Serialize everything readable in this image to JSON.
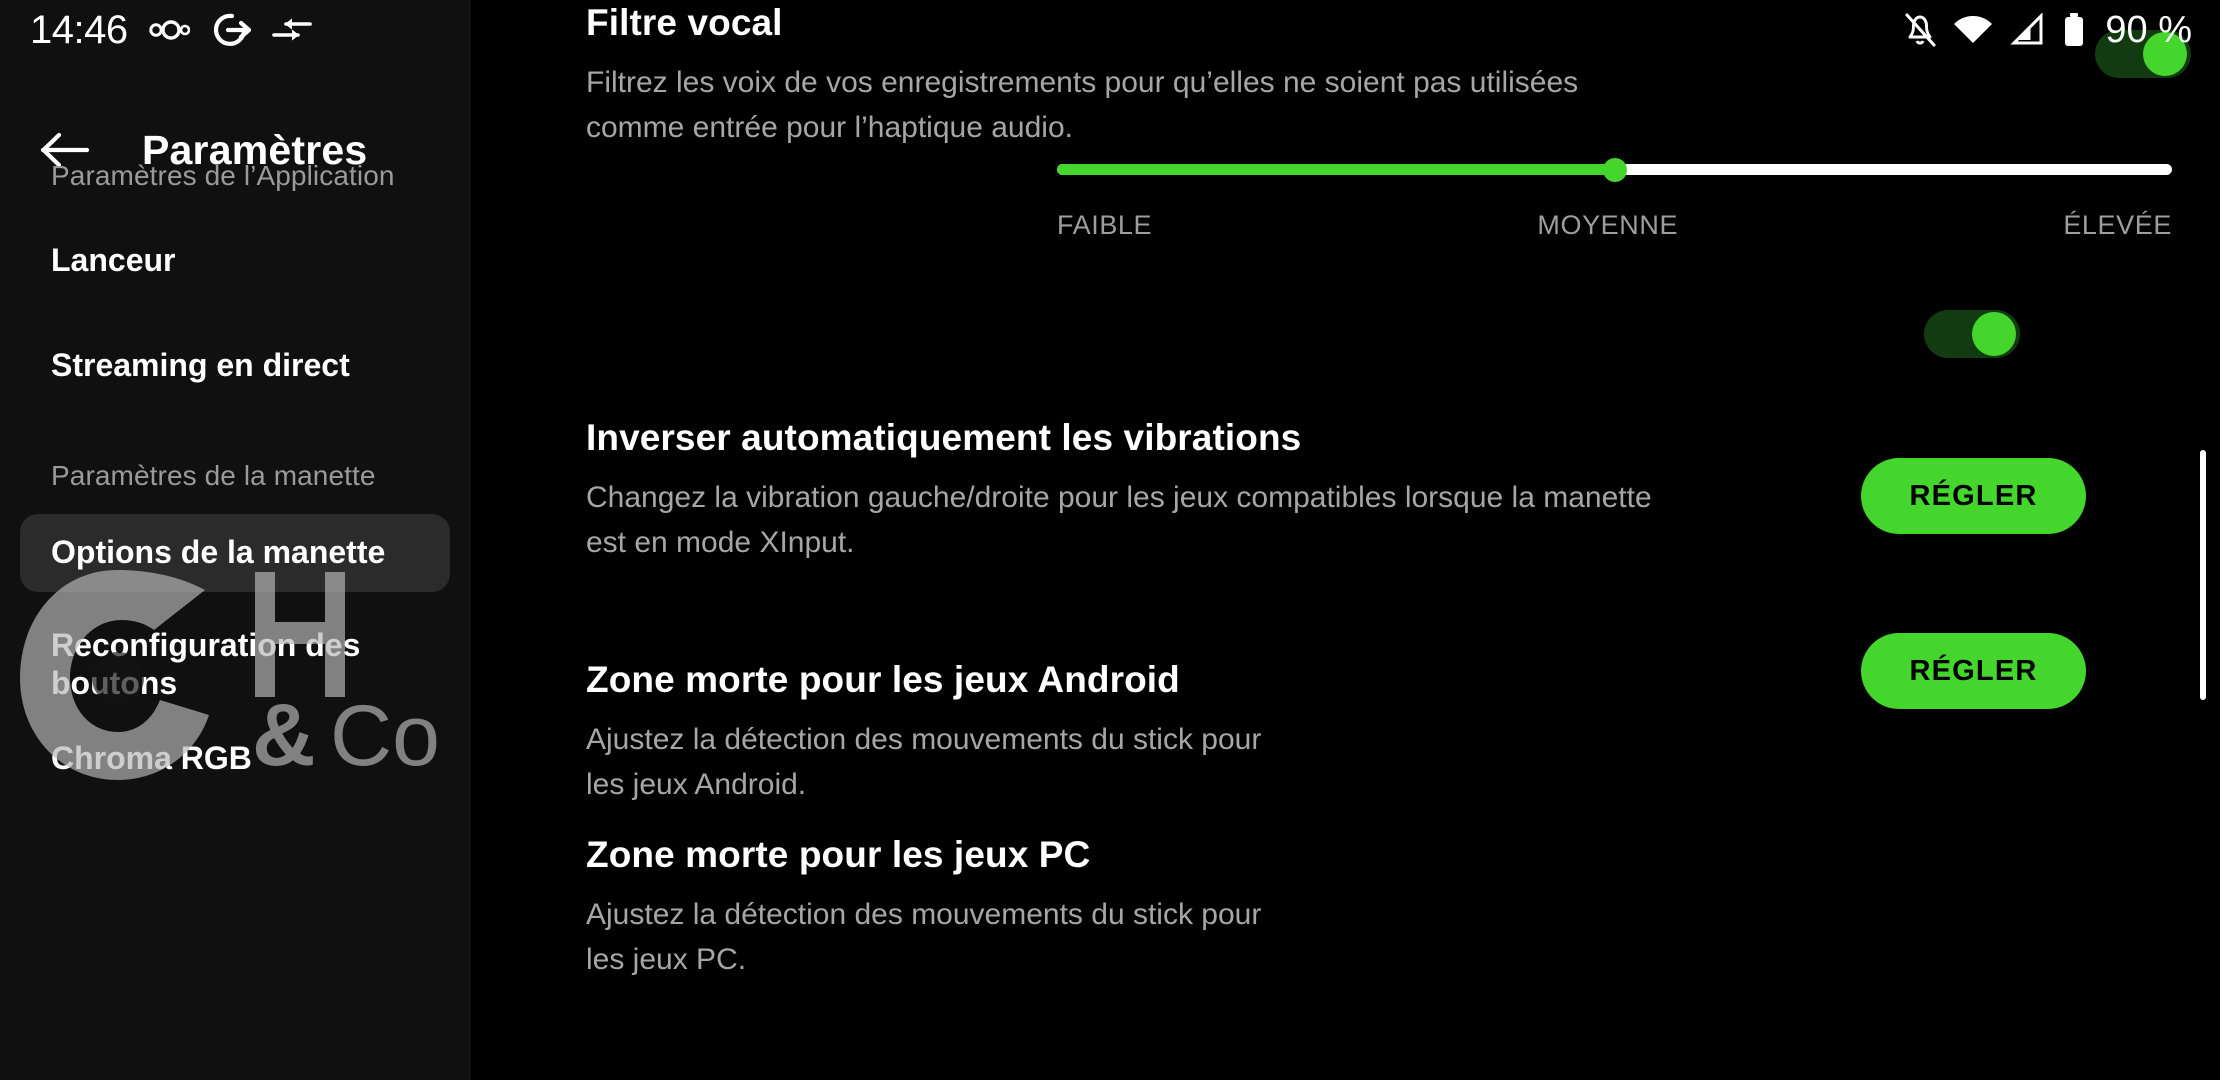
{
  "statusbar": {
    "clock": "14:46",
    "icons_left": [
      "infinity-icon",
      "power-exit-icon",
      "swap-arrows-icon"
    ],
    "icons_right": [
      "notifications-off-icon",
      "wifi-icon",
      "cellular-signal-icon",
      "battery-icon"
    ],
    "battery_label": "90 %"
  },
  "sidebar": {
    "back_icon": "back-arrow-icon",
    "title": "Paramètres",
    "group_app": "Paramètres de l’Application",
    "group_controller": "Paramètres de la manette",
    "items": [
      {
        "label": "Lanceur",
        "selected": false
      },
      {
        "label": "Streaming en direct",
        "selected": false
      },
      {
        "label": "Options de la manette",
        "selected": true
      },
      {
        "label": "Reconfiguration des boutons",
        "selected": false
      },
      {
        "label": "Chroma RGB",
        "selected": false
      }
    ]
  },
  "watermark": {
    "text_h": "H",
    "text_amp": "&",
    "text_co": "Co"
  },
  "main": {
    "voice_filter": {
      "title": "Filtre vocal",
      "description": "Filtrez les voix de vos enregistrements pour qu’elles ne soient pas utilisées comme entrée pour l’haptique audio.",
      "toggle_on": true,
      "slider": {
        "value_percent": 50,
        "labels": [
          "FAIBLE",
          "MOYENNE",
          "ÉLEVÉE"
        ]
      }
    },
    "auto_swap_vibration": {
      "title": "Inverser automatiquement les vibrations",
      "description": "Changez la vibration gauche/droite pour les jeux compatibles lorsque la manette est en mode XInput.",
      "toggle_on": true
    },
    "deadzone_android": {
      "title": "Zone morte pour les jeux Android",
      "description": "Ajustez la détection des mouvements du stick pour les jeux Android.",
      "button_label": "RÉGLER"
    },
    "deadzone_pc": {
      "title": "Zone morte pour les jeux PC",
      "description": "Ajustez la détection des mouvements du stick pour les jeux PC.",
      "button_label": "RÉGLER"
    }
  },
  "colors": {
    "accent_green": "#44d62c",
    "toggle_track": "#123b12",
    "sidebar_bg": "#101010",
    "selected_item_bg": "#2b2b2b",
    "muted_text": "#a6a6a6"
  }
}
